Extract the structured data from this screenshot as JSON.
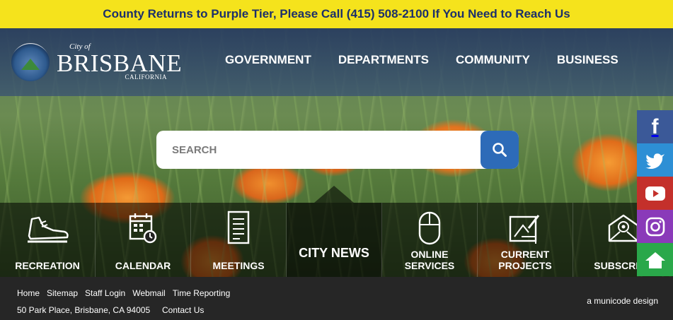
{
  "alert": {
    "text": "County Returns to Purple Tier, Please Call (415) 508-2100 If You Need to Reach Us"
  },
  "logo": {
    "city_of": "City of",
    "name": "BRISBANE",
    "state": "CALIFORNIA"
  },
  "nav": {
    "items": [
      "GOVERNMENT",
      "DEPARTMENTS",
      "COMMUNITY",
      "BUSINESS"
    ]
  },
  "search": {
    "placeholder": "SEARCH"
  },
  "tiles": [
    {
      "label": "RECREATION",
      "icon": "sneaker-icon"
    },
    {
      "label": "CALENDAR",
      "icon": "calendar-icon"
    },
    {
      "label": "MEETINGS",
      "icon": "document-icon"
    },
    {
      "label": "CITY NEWS",
      "icon": "none"
    },
    {
      "label": "ONLINE SERVICES",
      "icon": "mouse-icon"
    },
    {
      "label": "CURRENT PROJECTS",
      "icon": "blueprint-icon"
    },
    {
      "label": "SUBSCRIBE",
      "icon": "envelope-icon"
    }
  ],
  "social": [
    {
      "name": "facebook-icon",
      "glyph": "f",
      "color": "#3b5998"
    },
    {
      "name": "twitter-icon",
      "glyph": "",
      "color": "#2d8fd5"
    },
    {
      "name": "youtube-icon",
      "glyph": "",
      "color": "#c4302b"
    },
    {
      "name": "instagram-icon",
      "glyph": "",
      "color": "#8a3ab9"
    },
    {
      "name": "home-icon",
      "glyph": "",
      "color": "#2aa84a"
    }
  ],
  "footer": {
    "links": [
      "Home",
      "Sitemap",
      "Staff Login",
      "Webmail",
      "Time Reporting"
    ],
    "address": "50 Park Place, Brisbane, CA 94005",
    "contact": "Contact Us",
    "credit": "a municode design"
  },
  "colors": {
    "alert_bg": "#f5e31c",
    "alert_text": "#1c2f6b",
    "search_button": "#2d6bb8",
    "footer_bg": "#262626"
  }
}
